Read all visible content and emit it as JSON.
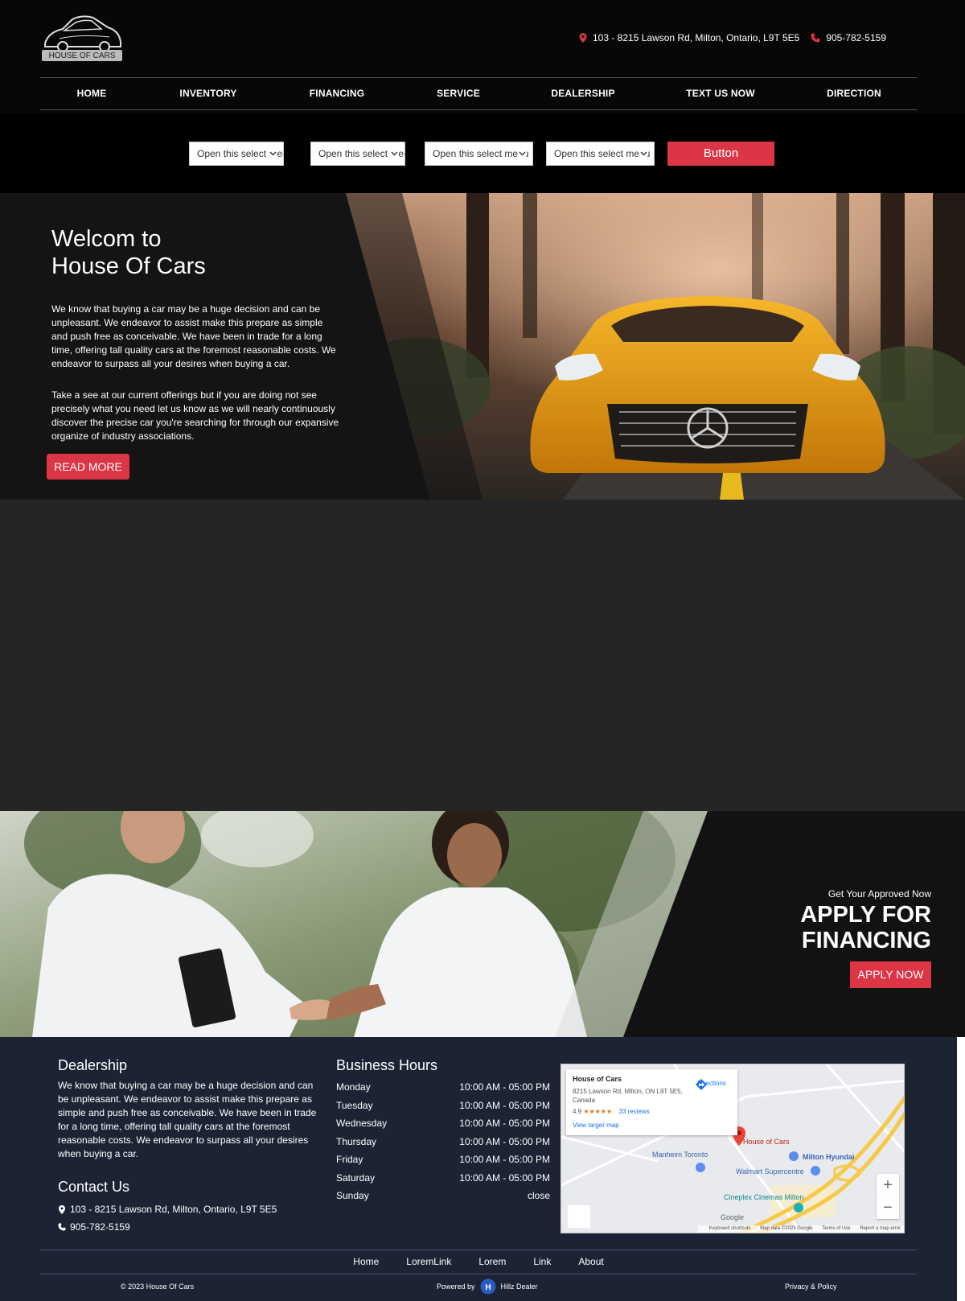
{
  "brand": {
    "logo_text": "HOUSE OF CARS"
  },
  "header": {
    "address": "103 - 8215 Lawson Rd, Milton, Ontario, L9T 5E5",
    "phone": "905-782-5159"
  },
  "nav": [
    {
      "label": "HOME"
    },
    {
      "label": "INVENTORY"
    },
    {
      "label": "FINANCING"
    },
    {
      "label": "SERVICE"
    },
    {
      "label": "DEALERSHIP"
    },
    {
      "label": "TEXT US NOW"
    },
    {
      "label": "DIRECTION"
    }
  ],
  "search": {
    "selects": [
      {
        "value": "Open this select menu"
      },
      {
        "value": "Open this select menu"
      },
      {
        "value": "Open this select menu"
      },
      {
        "value": "Open this select menu"
      }
    ],
    "button_label": "Button"
  },
  "hero": {
    "title": "Welcom to\nHouse Of Cars",
    "paragraph1": "We know that buying a car may be a huge decision and can be unpleasant. We endeavor to assist make this prepare as simple and push free as conceivable. We have been in trade for a long time, offering tall quality cars at the foremost reasonable costs. We endeavor to surpass all your desires when buying a car.",
    "paragraph2": "Take a see at our current offerings but if you are doing not see precisely what you need let us know as we will nearly continuously discover the precise car you're searching for through our expansive organize of industry associations.",
    "button_label": "READ MORE"
  },
  "financing": {
    "kicker": "Get Your Approved Now",
    "title": "APPLY FOR\nFINANCING",
    "button_label": "APPLY NOW"
  },
  "footer": {
    "dealership_heading": "Dealership",
    "dealership_text": "We know that buying a car may be a huge decision and can be unpleasant. We endeavor to assist make this prepare as simple and push free as conceivable. We have been in trade for a long time, offering tall quality cars at the foremost reasonable costs. We endeavor to surpass all your desires when buying a car.",
    "contact_heading": "Contact Us",
    "contact_address": "103 - 8215 Lawson Rd, Milton, Ontario, L9T 5E5",
    "contact_phone": "905-782-5159",
    "hours_heading": "Business Hours",
    "hours": [
      {
        "day": "Monday",
        "time": "10:00 AM - 05:00 PM"
      },
      {
        "day": "Tuesday",
        "time": "10:00 AM - 05:00 PM"
      },
      {
        "day": "Wednesday",
        "time": "10:00 AM - 05:00 PM"
      },
      {
        "day": "Thursday",
        "time": "10:00 AM - 05:00 PM"
      },
      {
        "day": "Friday",
        "time": "10:00 AM - 05:00 PM"
      },
      {
        "day": "Saturday",
        "time": "10:00 AM - 05:00 PM"
      },
      {
        "day": "Sunday",
        "time": "close"
      }
    ],
    "links": [
      {
        "label": "Home"
      },
      {
        "label": "LoremLink"
      },
      {
        "label": "Lorem"
      },
      {
        "label": "Link"
      },
      {
        "label": "About"
      }
    ],
    "copyright": "© 2023 House Of Cars",
    "powered_by": "Powered by",
    "powered_brand": "Hillz Dealer",
    "privacy": "Privacy & Policy"
  },
  "map": {
    "place_name": "House of Cars",
    "place_address": "8215 Lawson Rd, Milton, ON L9T 5E5, Canada",
    "rating": "4.9",
    "stars": "★★★★★",
    "reviews": "33 reviews",
    "directions": "Directions",
    "larger_map": "View larger map",
    "pin_label": "House of Cars",
    "labels": {
      "manheim": "Manheim Toronto",
      "hyundai": "Milton Hyundai",
      "walmart": "Walmart Supercentre",
      "cineplex": "Cineplex Cinemas Milton",
      "google": "Google"
    },
    "zoom_in": "+",
    "zoom_out": "−",
    "footer": {
      "shortcuts": "Keyboard shortcuts",
      "data": "Map data ©2023 Google",
      "terms": "Terms of Use",
      "report": "Report a map error"
    }
  },
  "colors": {
    "accent": "#dc3545",
    "header_bg": "#070707",
    "footer_bg": "#1c2434",
    "car": "#f0a51c"
  }
}
